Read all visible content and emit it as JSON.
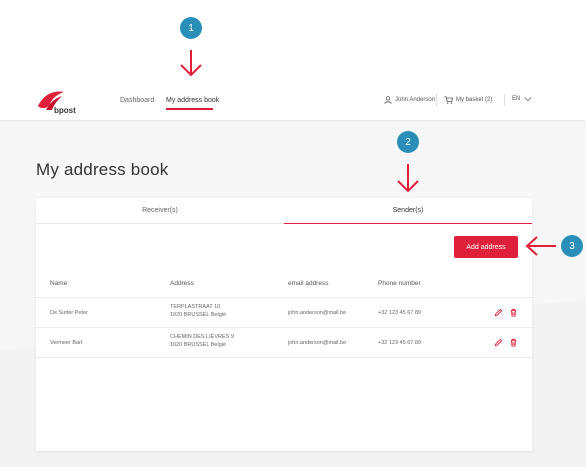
{
  "callouts": [
    "1",
    "2",
    "3"
  ],
  "header": {
    "logo_text": "bpost",
    "nav": {
      "dashboard": "Dashboard",
      "address_book": "My address book"
    },
    "user": "John Anderson",
    "basket": "My basket (2)",
    "language": "EN"
  },
  "page": {
    "title": "My address book"
  },
  "tabs": {
    "receivers": "Receiver(s)",
    "senders": "Sender(s)"
  },
  "actions": {
    "add_address": "Add address"
  },
  "table": {
    "headers": {
      "name": "Name",
      "address": "Address",
      "email": "email address",
      "phone": "Phone number"
    },
    "rows": [
      {
        "name": "De Sutter Peter",
        "address_line1": "TERPLASTRAAT 10",
        "address_line2": "1020 BRUSSEL België",
        "email": "john.anderson@mail.be",
        "phone": "+32 123 45 67 89"
      },
      {
        "name": "Vermeer Bart",
        "address_line1": "CHEMIN DES LIÈVRES 9",
        "address_line2": "1020 BRUSSEL België",
        "email": "john.anderson@mail.be",
        "phone": "+32 123 45 67 89"
      }
    ]
  },
  "colors": {
    "accent": "#e0203a",
    "callout": "#2a8fb8"
  },
  "icons": [
    "user-icon",
    "basket-icon",
    "chevron-down-icon",
    "edit-icon",
    "delete-icon",
    "arrow-down-icon",
    "arrow-left-icon"
  ]
}
